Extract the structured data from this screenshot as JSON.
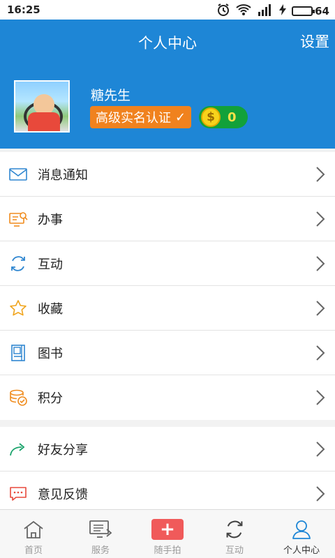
{
  "status_bar": {
    "time": "16:25",
    "battery": "64",
    "battery_level": 0.64
  },
  "header": {
    "title": "个人中心",
    "settings_label": "设置"
  },
  "profile": {
    "username": "糖先生",
    "auth_badge": "高级实名认证",
    "coins": "0"
  },
  "menu": {
    "items": [
      {
        "label": "消息通知",
        "icon": "mail-icon"
      },
      {
        "label": "办事",
        "icon": "work-icon"
      },
      {
        "label": "互动",
        "icon": "refresh-icon"
      },
      {
        "label": "收藏",
        "icon": "star-icon"
      },
      {
        "label": "图书",
        "icon": "book-icon"
      },
      {
        "label": "积分",
        "icon": "points-icon"
      }
    ],
    "secondary": [
      {
        "label": "好友分享",
        "icon": "share-icon"
      },
      {
        "label": "意见反馈",
        "icon": "feedback-icon"
      }
    ]
  },
  "tabs": [
    {
      "label": "首页",
      "icon": "home-icon"
    },
    {
      "label": "服务",
      "icon": "service-icon"
    },
    {
      "label": "随手拍",
      "icon": "plus-icon"
    },
    {
      "label": "互动",
      "icon": "refresh-icon"
    },
    {
      "label": "个人中心",
      "icon": "user-icon",
      "active": true
    }
  ],
  "colors": {
    "primary": "#1e86d6",
    "badge_orange": "#f0821e",
    "coin_green": "#12a13a",
    "plus_red": "#f05a5a"
  }
}
